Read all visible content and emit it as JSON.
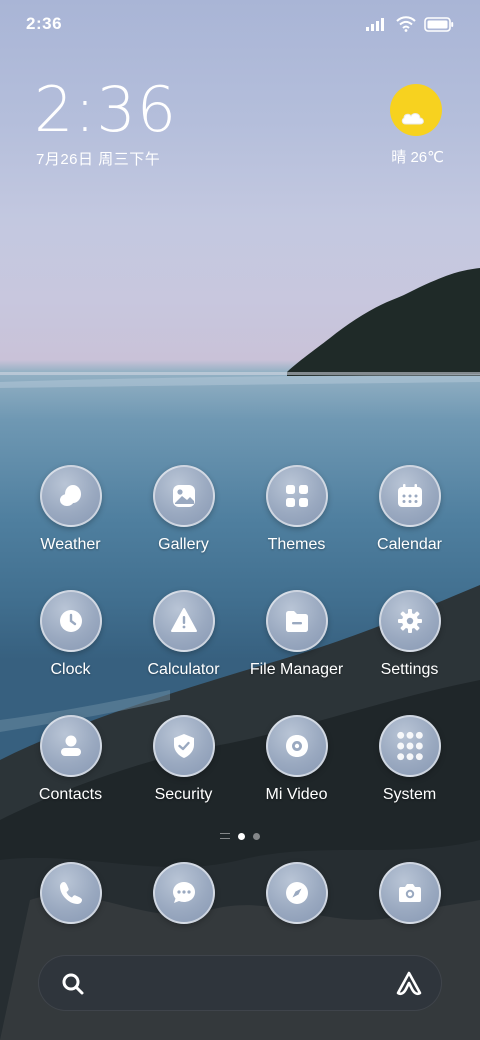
{
  "status_bar": {
    "time": "2:36",
    "icons": [
      "signal-icon",
      "wifi-icon",
      "battery-icon"
    ]
  },
  "clock_widget": {
    "time": "2:36",
    "date": "7月26日 周三下午"
  },
  "weather_widget": {
    "icon": "sun-cloud-icon",
    "text": "晴 26℃",
    "sun_color": "#f7d21f"
  },
  "apps": [
    {
      "label": "Weather",
      "icon": "weather-icon"
    },
    {
      "label": "Gallery",
      "icon": "gallery-icon"
    },
    {
      "label": "Themes",
      "icon": "themes-icon"
    },
    {
      "label": "Calendar",
      "icon": "calendar-icon"
    },
    {
      "label": "Clock",
      "icon": "clock-icon"
    },
    {
      "label": "Calculator",
      "icon": "calculator-icon"
    },
    {
      "label": "File Manager",
      "icon": "file-manager-icon"
    },
    {
      "label": "Settings",
      "icon": "settings-icon"
    },
    {
      "label": "Contacts",
      "icon": "contacts-icon"
    },
    {
      "label": "Security",
      "icon": "security-icon"
    },
    {
      "label": "Mi Video",
      "icon": "mi-video-icon"
    },
    {
      "label": "System",
      "icon": "system-folder-icon"
    }
  ],
  "page_indicator": {
    "pages": 2,
    "current": 1
  },
  "dock": [
    {
      "icon": "phone-icon"
    },
    {
      "icon": "messages-icon"
    },
    {
      "icon": "browser-icon"
    },
    {
      "icon": "camera-icon"
    }
  ],
  "search_bar": {
    "left_icon": "search-icon",
    "right_icon": "assistant-icon"
  },
  "colors": {
    "icon_bg": "#9aa9c0",
    "text": "#ffffff"
  }
}
